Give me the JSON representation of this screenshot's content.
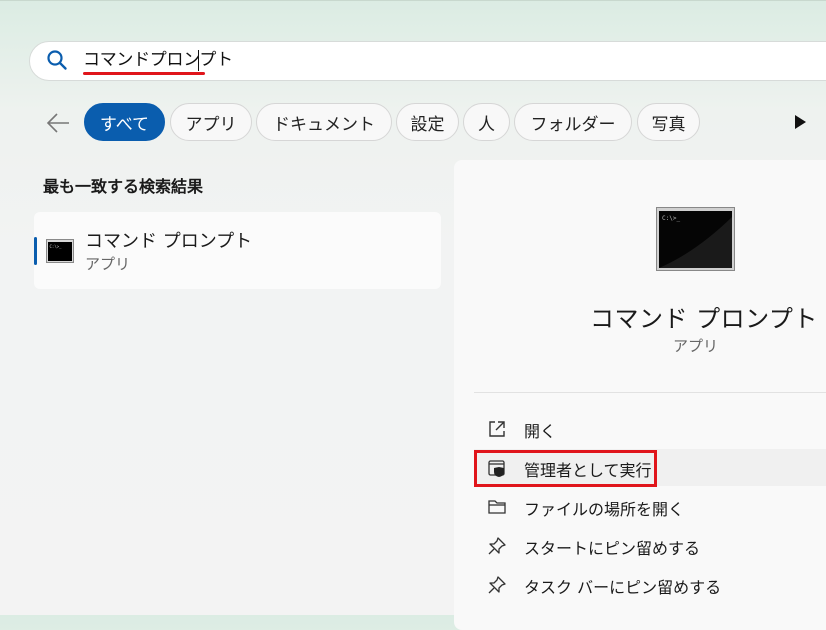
{
  "search": {
    "query": "コマンドプロンプト"
  },
  "filters": [
    {
      "label": "すべて",
      "active": true
    },
    {
      "label": "アプリ",
      "active": false
    },
    {
      "label": "ドキュメント",
      "active": false
    },
    {
      "label": "設定",
      "active": false
    },
    {
      "label": "人",
      "active": false
    },
    {
      "label": "フォルダー",
      "active": false
    },
    {
      "label": "写真",
      "active": false
    }
  ],
  "best_match": {
    "heading": "最も一致する検索結果",
    "name": "コマンド プロンプト",
    "type": "アプリ",
    "icon": "command-prompt-icon"
  },
  "detail": {
    "name": "コマンド プロンプト",
    "type": "アプリ",
    "icon": "command-prompt-icon",
    "actions": [
      {
        "label": "開く",
        "icon": "open-external-icon"
      },
      {
        "label": "管理者として実行",
        "icon": "shield-admin-icon"
      },
      {
        "label": "ファイルの場所を開く",
        "icon": "folder-icon"
      },
      {
        "label": "スタートにピン留めする",
        "icon": "pin-icon"
      },
      {
        "label": "タスク バーにピン留めする",
        "icon": "pin-icon"
      }
    ]
  },
  "colors": {
    "accent": "#0a5dae",
    "annotation_red": "#e0151b"
  }
}
